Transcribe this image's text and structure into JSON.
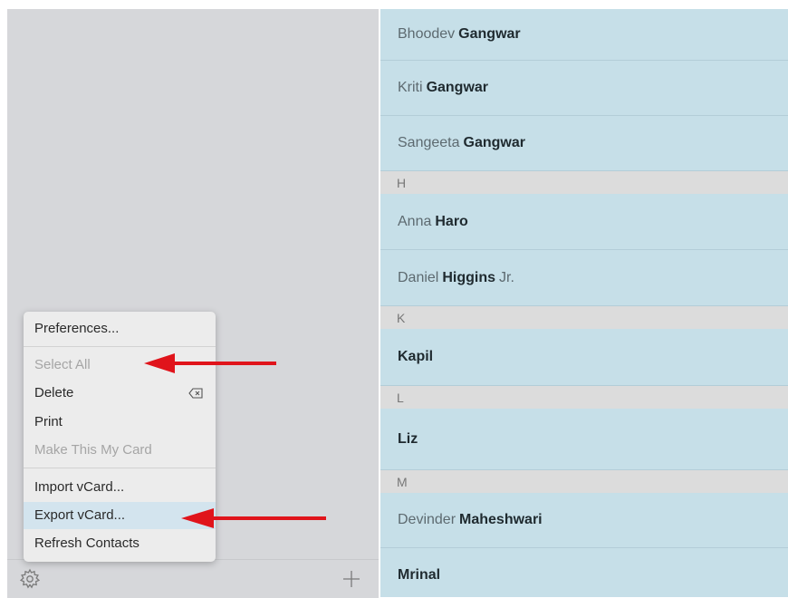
{
  "sidebar": {
    "gear_icon": "gear-icon",
    "add_icon": "plus-icon"
  },
  "menu": {
    "preferences": "Preferences...",
    "select_all": "Select All",
    "delete": "Delete",
    "delete_icon": "delete-key-icon",
    "print": "Print",
    "make_my_card": "Make This My Card",
    "import_vcard": "Import vCard...",
    "export_vcard": "Export vCard...",
    "refresh": "Refresh Contacts"
  },
  "contacts": {
    "rows": [
      {
        "first": "Bhoodev",
        "last": "Gangwar",
        "suffix": ""
      },
      {
        "first": "Kriti",
        "last": "Gangwar",
        "suffix": ""
      },
      {
        "first": "Sangeeta",
        "last": "Gangwar",
        "suffix": ""
      },
      {
        "header": "H"
      },
      {
        "first": "Anna",
        "last": "Haro",
        "suffix": ""
      },
      {
        "first": "Daniel",
        "last": "Higgins",
        "suffix": "Jr."
      },
      {
        "header": "K"
      },
      {
        "first": "",
        "last": "Kapil",
        "suffix": ""
      },
      {
        "header": "L"
      },
      {
        "first": "",
        "last": "Liz",
        "suffix": ""
      },
      {
        "header": "M"
      },
      {
        "first": "Devinder",
        "last": "Maheshwari",
        "suffix": ""
      },
      {
        "first": "",
        "last": "Mrinal",
        "suffix": ""
      }
    ]
  },
  "colors": {
    "list_row": "#c6dfe8",
    "section_header": "#dcdcdc",
    "sidebar": "#d6d7da",
    "menu": "#ececec",
    "menu_highlight": "#d3e4ee",
    "arrow": "#e0141b"
  }
}
